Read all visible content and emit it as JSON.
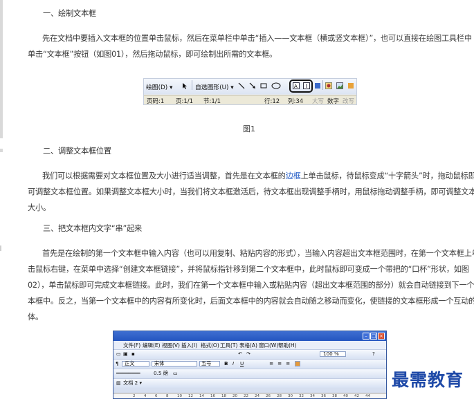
{
  "article": {
    "s1_heading": "一、绘制文本框",
    "s1_para_l1": "先在文档中要插入文本框的位置单击鼠标，然后在菜单栏中单击“插入——文本框（横或竖文本框）”，也可以直接在绘图工具栏中",
    "s1_para_l2": "单击“文本框”按钮（如图01），然后拖动鼠标，即可绘制出所需的文本框。",
    "fig1_caption": "图1",
    "s2_heading": "二、调整文本框位置",
    "s2_para_l1a": "我们可以根据需要对文本框位置及大小进行适当调整，首先是在文本框的",
    "s2_para_l1_link": "边框",
    "s2_para_l1b": "上单击鼠标，待鼠标变成“十字箭头”时，拖动鼠标即",
    "s2_para_l2": "可调整文本框位置。如果调整文本框大小时，当我们将文本框激活后，待文本框出现调整手柄时，用鼠标拖动调整手柄，即可调整文本框",
    "s2_para_l3": "大小。",
    "s3_heading": "三、把文本框内文字“串”起来",
    "s3_para_l1": "首先是在绘制的第一个文本框中输入内容（也可以用复制、粘贴内容的形式），当输入内容超出文本框范围时，在第一个文本框上单",
    "s3_para_l2": "击鼠标右键，在菜单中选择“创建文本框链接”，并将鼠标指针移到第二个文本框中，此时鼠标即可变成一个带把的“口杯”形状，如图",
    "s3_para_l3": "02），单击鼠标即可完成文本框链接。此时，我们在第一个文本框中输入或粘贴内容（超出文本框范围的部分）就会自动链接到下一个文",
    "s3_para_l4": "本框中。反之，当第一个文本框中的内容有所变化时，后面文本框中的内容就会自动随之移动而变化，使链接的文本框形成一个互动的整",
    "s3_para_l5": "体。"
  },
  "fig1": {
    "draw_menu": "绘图(D) ▾",
    "autoshape_menu": "自选图形(U) ▾",
    "status": {
      "page": "页码:1",
      "pages": "页:1/1",
      "section": "节:1/1",
      "row": "行:12",
      "col": "列:34",
      "ovr": "大写",
      "num": "数字",
      "rec": "改写"
    }
  },
  "fig2": {
    "menu": [
      "文件(F)",
      "编辑(E)",
      "视图(V)",
      "插入(I)",
      "格式(O)",
      "工具(T)",
      "表格(A)",
      "窗口(W)",
      "帮助(H)"
    ],
    "zoom": "100 %",
    "style_value": "正文",
    "font_value": "宋体",
    "size_value": "五号",
    "line_width": "0.5 磅",
    "doc_tab": "文档 2 ▾",
    "ruler": [
      "2",
      "4",
      "6",
      "8",
      "10",
      "12",
      "14",
      "16",
      "18",
      "20",
      "22",
      "24",
      "26",
      "28",
      "30",
      "32",
      "34",
      "36",
      "38",
      "40",
      "42",
      "44"
    ]
  },
  "brand": "最需教育",
  "colors": {
    "link": "#2a61c8",
    "brand": "#1f4aa8",
    "title_bar": "#2455c0"
  }
}
